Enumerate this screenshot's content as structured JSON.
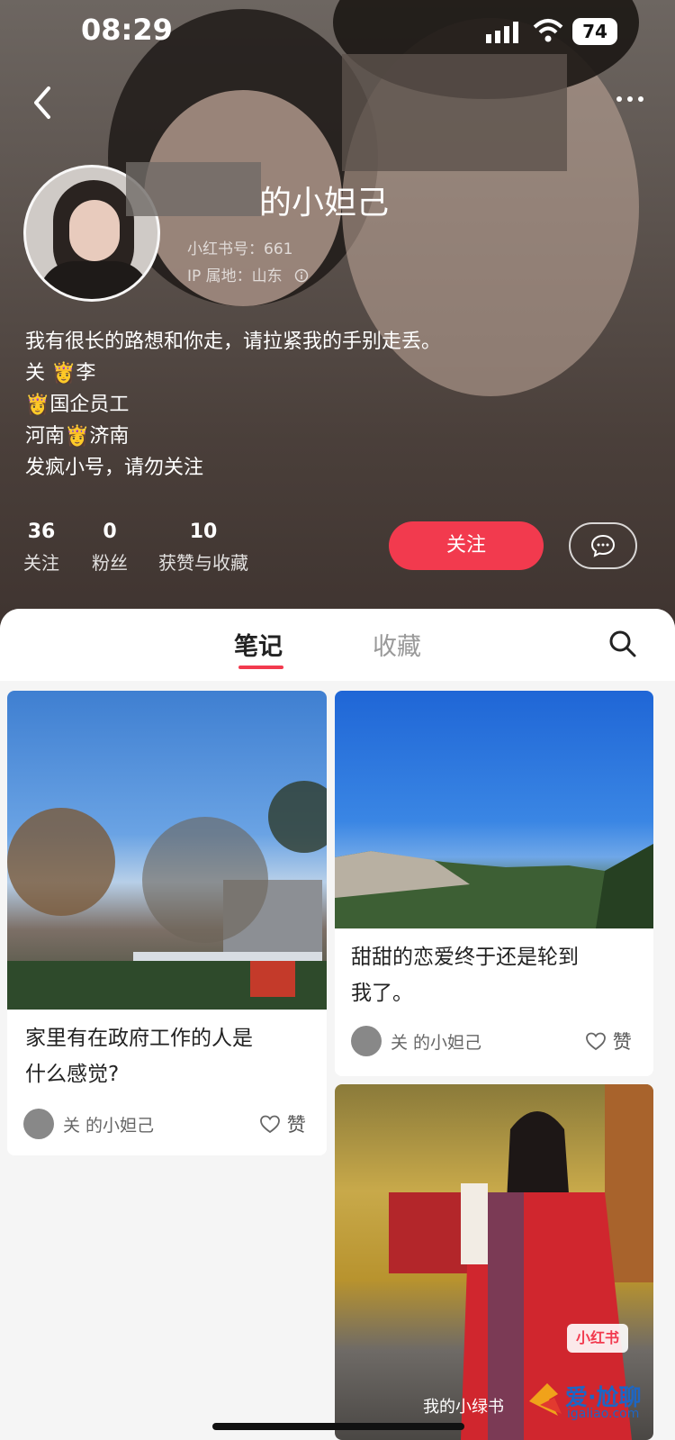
{
  "status_bar": {
    "time": "08:29",
    "battery": "74"
  },
  "profile": {
    "nickname": "的小妲己",
    "id_label": "小红书号：661",
    "ip_label": "IP 属地：山东",
    "bio": [
      "我有很长的路想和你走，请拉紧我的手别走丢。",
      "关      👸李",
      "      👸国企员工",
      "河南👸济南",
      "发疯小号，请勿关注"
    ],
    "stats": [
      {
        "value": "36",
        "label": "关注"
      },
      {
        "value": "0",
        "label": "粉丝"
      },
      {
        "value": "10",
        "label": "获赞与收藏"
      }
    ],
    "follow_label": "关注"
  },
  "tabs": {
    "notes": "笔记",
    "collections": "收藏"
  },
  "notes": [
    {
      "title_line1": "家里有在政府工作的人是",
      "title_line2": "什么感觉?",
      "author": "关  的小妲己",
      "like_label": "赞"
    },
    {
      "title_line1": "甜甜的恋爱终于还是轮到",
      "title_line2": "我了。",
      "author": "关  的小妲己",
      "like_label": "赞"
    },
    {
      "badge": "小红书",
      "caption": "我的小绿书"
    }
  ],
  "watermark": {
    "text": "爱·尬聊",
    "url": "igaliao.com"
  }
}
